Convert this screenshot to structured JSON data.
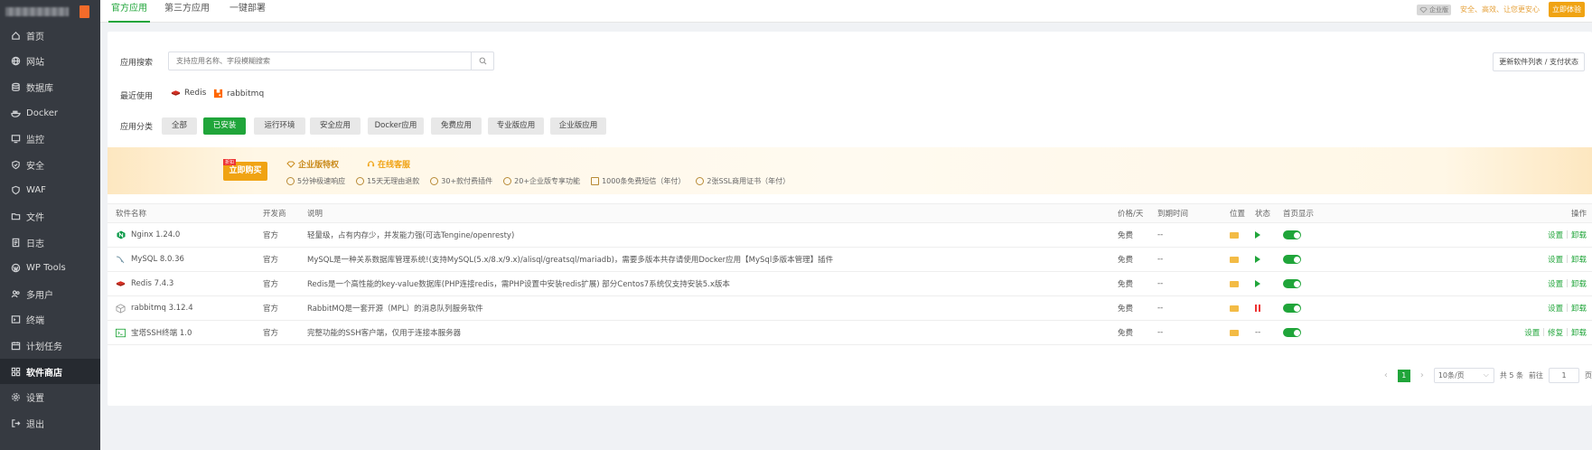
{
  "sidebar": {
    "items": [
      {
        "label": "首页",
        "icon": "home-icon"
      },
      {
        "label": "网站",
        "icon": "globe-icon"
      },
      {
        "label": "数据库",
        "icon": "database-icon"
      },
      {
        "label": "Docker",
        "icon": "docker-icon"
      },
      {
        "label": "监控",
        "icon": "monitor-icon"
      },
      {
        "label": "安全",
        "icon": "shield-icon"
      },
      {
        "label": "WAF",
        "icon": "waf-shield-icon"
      },
      {
        "label": "文件",
        "icon": "folder-icon"
      },
      {
        "label": "日志",
        "icon": "log-icon"
      },
      {
        "label": "WP Tools",
        "icon": "wordpress-icon"
      },
      {
        "label": "多用户",
        "icon": "users-icon"
      },
      {
        "label": "终端",
        "icon": "terminal-icon"
      },
      {
        "label": "计划任务",
        "icon": "schedule-icon"
      },
      {
        "label": "软件商店",
        "icon": "store-icon"
      },
      {
        "label": "设置",
        "icon": "gear-icon"
      },
      {
        "label": "退出",
        "icon": "logout-icon"
      }
    ],
    "active_label": "软件商店"
  },
  "tabs": [
    "官方应用",
    "第三方应用",
    "一键部署"
  ],
  "promo": {
    "badge": "企业版",
    "text": "安全、高效、让您更安心",
    "button": "立即体验"
  },
  "search": {
    "label": "应用搜索",
    "placeholder": "支持应用名称、字段模糊搜索"
  },
  "update_button": "更新软件列表 / 支付状态",
  "recent": {
    "label": "最近使用",
    "items": [
      "Redis",
      "rabbitmq"
    ]
  },
  "category": {
    "label": "应用分类",
    "items": [
      "全部",
      "已安装",
      "运行环境",
      "安全应用",
      "Docker应用",
      "免费应用",
      "专业版应用",
      "企业版应用"
    ],
    "active": "已安装"
  },
  "banner": {
    "buy_button": "立即购买",
    "buy_tag": "折扣",
    "title1": "企业版特权",
    "title2": "在线客服",
    "features": [
      "5分钟极速响应",
      "15天无理由退款",
      "30+款付费插件",
      "20+企业版专享功能",
      "1000条免费短信（年付）",
      "2张SSL商用证书（年付）"
    ]
  },
  "table": {
    "headers": [
      "软件名称",
      "开发商",
      "说明",
      "价格/天",
      "到期时间",
      "位置",
      "状态",
      "首页显示",
      "操作"
    ],
    "rows": [
      {
        "name": "Nginx 1.24.0",
        "dev": "官方",
        "desc": "轻量级，占有内存少，并发能力强(可选Tengine/openresty)",
        "price": "免费",
        "expire": "--",
        "status": "running",
        "ops": [
          "设置",
          "卸载"
        ]
      },
      {
        "name": "MySQL 8.0.36",
        "dev": "官方",
        "desc": "MySQL是一种关系数据库管理系统!(支持MySQL(5.x/8.x/9.x)/alisql/greatsql/mariadb)，需要多版本共存请使用Docker应用【MySql多版本管理】插件",
        "price": "免费",
        "expire": "--",
        "status": "running",
        "ops": [
          "设置",
          "卸载"
        ]
      },
      {
        "name": "Redis 7.4.3",
        "dev": "官方",
        "desc": "Redis是一个高性能的key-value数据库(PHP连接redis，需PHP设置中安装redis扩展) 部分Centos7系统仅支持安装5.x版本",
        "price": "免费",
        "expire": "--",
        "status": "running",
        "ops": [
          "设置",
          "卸载"
        ]
      },
      {
        "name": "rabbitmq 3.12.4",
        "dev": "官方",
        "desc": "RabbitMQ是一套开源（MPL）的消息队列服务软件",
        "price": "免费",
        "expire": "--",
        "status": "stopped",
        "ops": [
          "设置",
          "卸载"
        ]
      },
      {
        "name": "宝塔SSH终端 1.0",
        "dev": "官方",
        "desc": "完整功能的SSH客户端，仅用于连接本服务器",
        "price": "免费",
        "expire": "--",
        "status": "--",
        "ops": [
          "设置",
          "修复",
          "卸载"
        ]
      }
    ]
  },
  "pager": {
    "current": "1",
    "page_size": "10条/页",
    "total": "共 5 条",
    "goto_label": "前往",
    "goto_value": "1",
    "page_suffix": "页"
  },
  "colors": {
    "accent": "#20a53a",
    "sidebar_bg": "#363a41",
    "warning": "#f0a313"
  }
}
